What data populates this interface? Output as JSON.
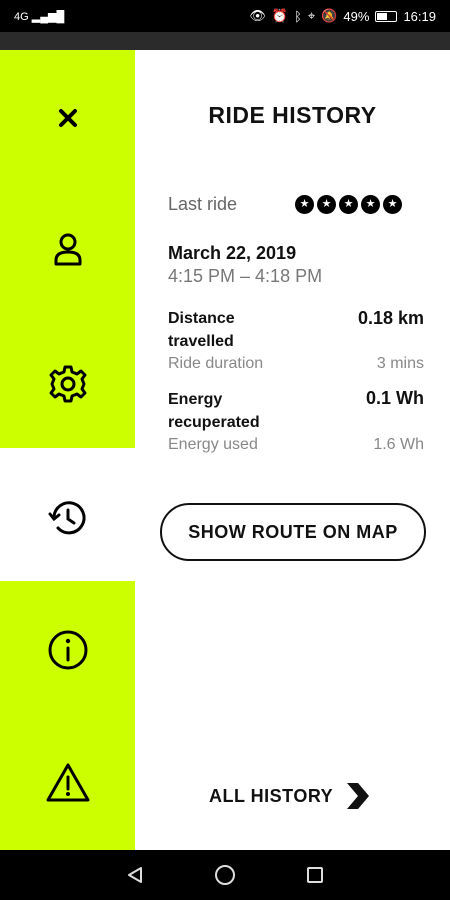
{
  "status_bar": {
    "network": "4G",
    "battery": "49%",
    "time": "16:19"
  },
  "sidebar": {
    "accent_color": "#ccff00",
    "icons": [
      "close-icon",
      "profile-icon",
      "settings-icon",
      "history-icon",
      "info-icon",
      "warning-icon"
    ],
    "active": "history-icon"
  },
  "ride_history": {
    "title": "RIDE HISTORY",
    "last_ride_label": "Last ride",
    "rating": 5,
    "date": "March 22, 2019",
    "time_range": "4:15 PM – 4:18 PM",
    "distance_label": "Distance travelled",
    "distance_value": "0.18 km",
    "duration_label": "Ride duration",
    "duration_value": "3 mins",
    "energy_recup_label": "Energy recuperated",
    "energy_recup_value": "0.1 Wh",
    "energy_used_label": "Energy used",
    "energy_used_value": "1.6 Wh",
    "show_route_label": "SHOW ROUTE ON MAP",
    "all_history_label": "ALL HISTORY"
  },
  "nav_bar": {
    "icons": [
      "back-icon",
      "home-icon",
      "recents-icon"
    ]
  }
}
